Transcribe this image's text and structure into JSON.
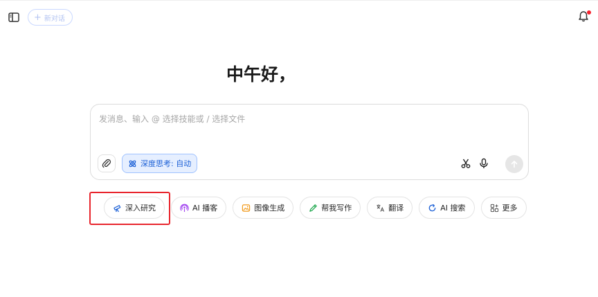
{
  "topbar": {
    "new_chat_label": "新对话"
  },
  "greeting": "中午好，",
  "input": {
    "placeholder": "发消息、输入 @ 选择技能或 / 选择文件",
    "deep_think_label": "深度思考: 自动"
  },
  "skills": [
    {
      "label": "深入研究",
      "icon": "telescope-icon",
      "color": "#1a5fd6"
    },
    {
      "label": "AI 播客",
      "icon": "podcast-icon",
      "color": "#a347f0"
    },
    {
      "label": "图像生成",
      "icon": "image-icon",
      "color": "#f29a1a"
    },
    {
      "label": "帮我写作",
      "icon": "pen-icon",
      "color": "#1aa64a"
    },
    {
      "label": "翻译",
      "icon": "translate-icon",
      "color": "#555555"
    },
    {
      "label": "AI 搜索",
      "icon": "search-refresh-icon",
      "color": "#1a5fd6"
    },
    {
      "label": "更多",
      "icon": "grid-plus-icon",
      "color": "#555555"
    }
  ],
  "colors": {
    "accent": "#1a5fd6",
    "highlight": "#e8242c",
    "notification_dot": "#f5222d"
  }
}
